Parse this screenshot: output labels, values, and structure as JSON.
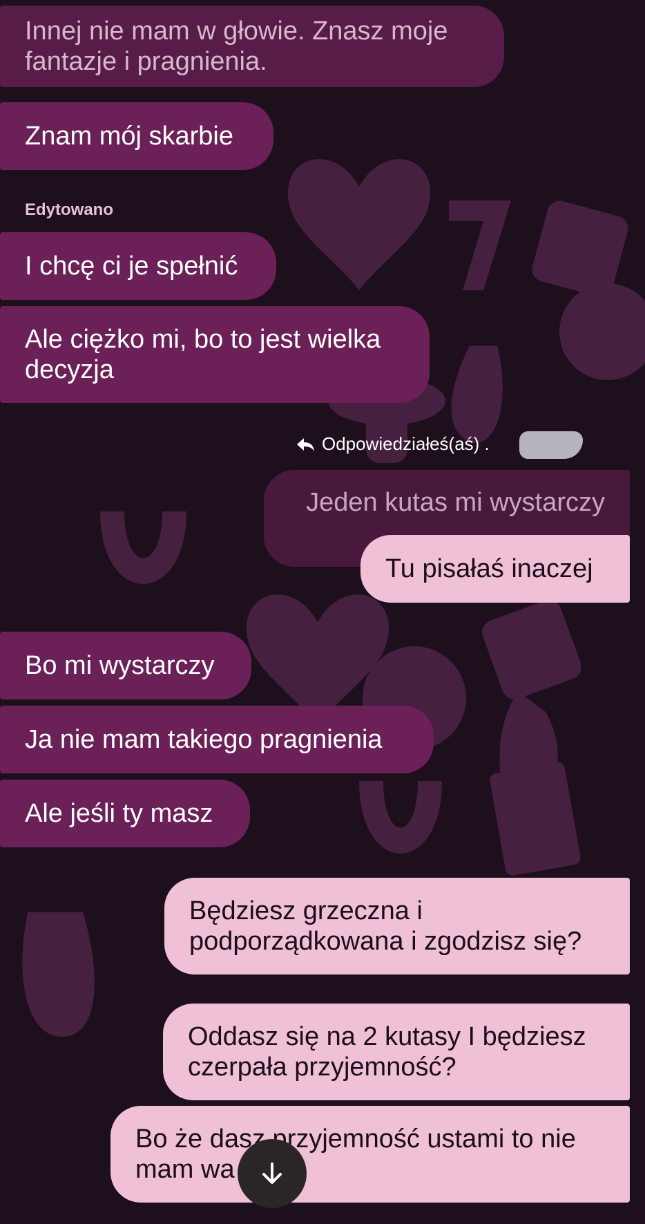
{
  "messages": [
    {
      "text": "Innej nie mam w głowie. Znasz moje\nfantazje i pragnienia.",
      "direction": "incoming"
    },
    {
      "text": "Znam mój skarbie",
      "direction": "incoming"
    },
    {
      "text": "I chcę ci je spełnić",
      "direction": "incoming"
    },
    {
      "text": "Ale ciężko mi, bo to jest wielka\ndecyzja",
      "direction": "incoming"
    },
    {
      "text": "Tu pisałaś inaczej",
      "direction": "outgoing"
    },
    {
      "text": "Bo mi wystarczy",
      "direction": "incoming"
    },
    {
      "text": "Ja nie mam takiego pragnienia",
      "direction": "incoming"
    },
    {
      "text": "Ale jeśli ty masz",
      "direction": "incoming"
    },
    {
      "text": "Będziesz grzeczna i\npodporządkowana i zgodzisz się?",
      "direction": "outgoing"
    },
    {
      "text": "Oddasz się na 2 kutasy I będziesz\nczerpała przyjemność?",
      "direction": "outgoing"
    },
    {
      "text": "Bo że dasz przyjemność ustami to nie\nmam wa        osci",
      "direction": "outgoing"
    }
  ],
  "edited_label": "Edytowano",
  "reply": {
    "label": "Odpowiedziałeś(aś) .",
    "quoted_text": "Jeden kutas mi wystarczy",
    "icon": "reply-arrow-icon"
  },
  "scroll_button": {
    "icon": "arrow-down-icon"
  },
  "colors": {
    "background": "#1d0f1c",
    "incoming_bubble": "#6b2157",
    "outgoing_bubble": "#f0c0d6"
  }
}
